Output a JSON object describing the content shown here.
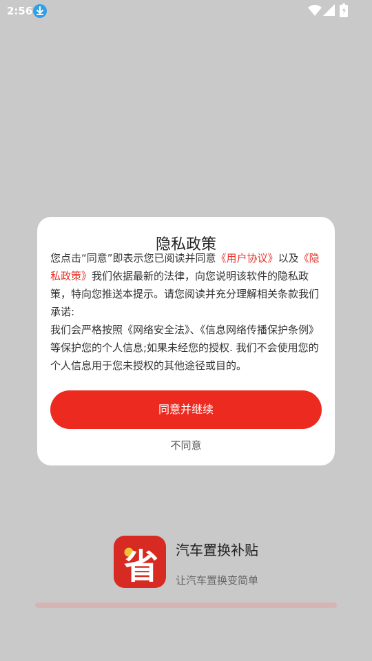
{
  "status_bar": {
    "time": "2:56",
    "icons": [
      "download-icon",
      "wifi-icon",
      "signal-icon",
      "battery-icon"
    ]
  },
  "dialog": {
    "title": "隐私政策",
    "body": {
      "part1": "您点击“同意”即表示您已阅读并同意",
      "user_agreement_link": "《用户协议》",
      "part2": "以及",
      "privacy_policy_link": "《隐私政策》",
      "part3": "我们依据最新的法律，向您说明该软件的隐私政策，特向您推送本提示。请您阅读并充分理解相关条款我们承诺:",
      "part4": "我们会严格按照《网络安全法》、《信息网络传播保护条例》等保护您的个人信息;如果未经您的授权. 我们不会使用您的个人信息用于您未授权的其他途径或目的。"
    },
    "agree_label": "同意并继续",
    "disagree_label": "不同意"
  },
  "splash": {
    "app_name": "汽车置换补贴",
    "tagline": "让汽车置换变简单",
    "logo_glyph": "省",
    "progress": 0
  },
  "colors": {
    "accent": "#ec2a1f",
    "link": "#e8332a",
    "overlay_bg": "#c9c9c9",
    "logo_bg": "#d62a22"
  }
}
